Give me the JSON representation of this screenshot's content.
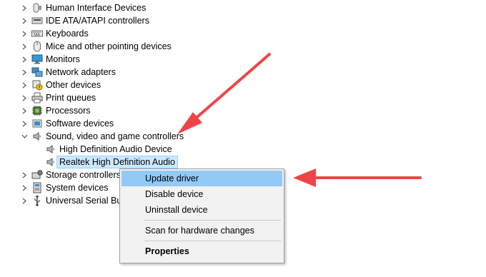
{
  "tree": {
    "categories": [
      {
        "label": "Human Interface Devices",
        "icon": "hid-icon"
      },
      {
        "label": "IDE ATA/ATAPI controllers",
        "icon": "ide-controller-icon"
      },
      {
        "label": "Keyboards",
        "icon": "keyboard-icon"
      },
      {
        "label": "Mice and other pointing devices",
        "icon": "mouse-icon"
      },
      {
        "label": "Monitors",
        "icon": "monitor-icon"
      },
      {
        "label": "Network adapters",
        "icon": "network-adapter-icon"
      },
      {
        "label": "Other devices",
        "icon": "unknown-device-icon"
      },
      {
        "label": "Print queues",
        "icon": "printer-icon"
      },
      {
        "label": "Processors",
        "icon": "processor-icon"
      },
      {
        "label": "Software devices",
        "icon": "software-device-icon"
      },
      {
        "label": "Sound, video and game controllers",
        "icon": "speaker-icon",
        "expanded": true
      },
      {
        "label": "Storage controllers",
        "icon": "storage-controller-icon"
      },
      {
        "label": "System devices",
        "icon": "system-device-icon"
      },
      {
        "label": "Universal Serial Bus",
        "icon": "usb-icon"
      }
    ],
    "sound_children": [
      {
        "label": "High Definition Audio Device",
        "icon": "speaker-icon"
      },
      {
        "label": "Realtek High Definition Audio",
        "icon": "speaker-icon",
        "selected": true
      }
    ]
  },
  "context_menu": {
    "items": [
      {
        "label": "Update driver",
        "highlighted": true
      },
      {
        "label": "Disable device"
      },
      {
        "label": "Uninstall device"
      },
      {
        "label": "Scan for hardware changes"
      },
      {
        "label": "Properties",
        "bold": true
      }
    ]
  },
  "annotations": {
    "arrow_color": "#ef4548"
  },
  "colors": {
    "selection_bg": "#cce8ff",
    "menu_highlight": "#91c9f7"
  }
}
